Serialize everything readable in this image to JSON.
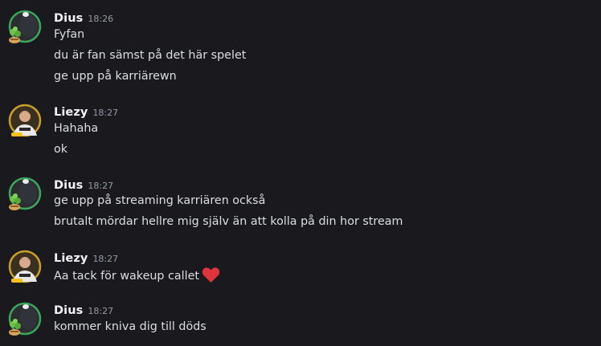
{
  "colors": {
    "background": "#1a1a1e",
    "username": "#f2f3f5",
    "timestamp": "#949ba4",
    "message": "#dbdee1",
    "heart": "#e0343c"
  },
  "groups": [
    {
      "author": "Dius",
      "time": "18:26",
      "avatar_icon": "dius-avatar",
      "messages": [
        "Fyfan",
        "du är fan sämst på det här spelet",
        "ge upp på karriärewn"
      ]
    },
    {
      "author": "Liezy",
      "time": "18:27",
      "avatar_icon": "liezy-avatar",
      "messages": [
        "Hahaha",
        "ok"
      ]
    },
    {
      "author": "Dius",
      "time": "18:27",
      "avatar_icon": "dius-avatar",
      "messages": [
        "ge upp på streaming karriären också",
        "brutalt mördar hellre mig själv än att kolla på din hor stream"
      ]
    },
    {
      "author": "Liezy",
      "time": "18:27",
      "avatar_icon": "liezy-avatar",
      "messages": [
        "Aa tack för wakeup callet"
      ],
      "emoji": "red-heart-icon"
    },
    {
      "author": "Dius",
      "time": "18:27",
      "avatar_icon": "dius-avatar",
      "messages": [
        "kommer kniva dig till döds"
      ]
    }
  ]
}
